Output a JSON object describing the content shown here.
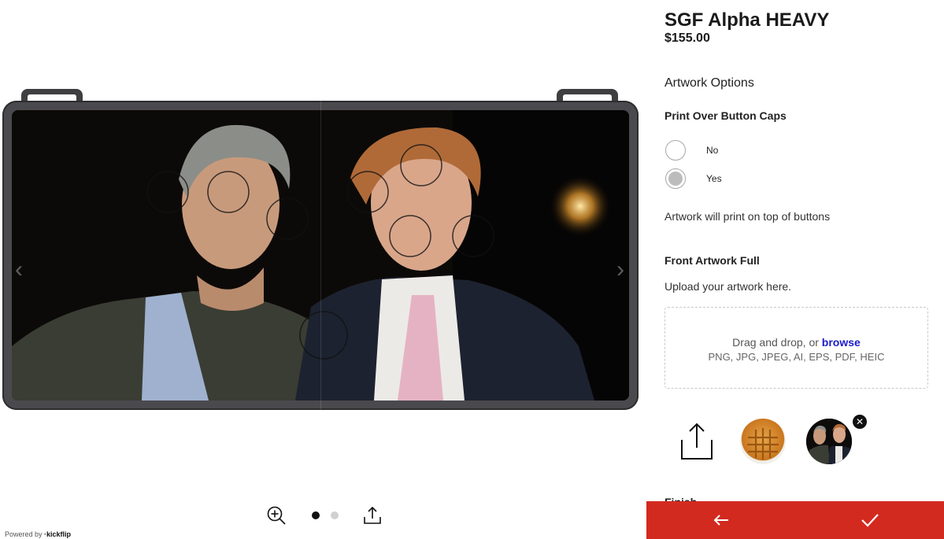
{
  "product": {
    "title": "SGF Alpha HEAVY",
    "price": "$155.00"
  },
  "options": {
    "section_title": "Artwork Options",
    "print_over": {
      "label": "Print Over Button Caps",
      "choices": [
        "No",
        "Yes"
      ],
      "selected": "Yes"
    },
    "note": "Artwork will print on top of buttons",
    "front_artwork": {
      "label": "Front Artwork Full",
      "hint": "Upload your artwork here.",
      "dropzone_text": "Drag and drop, or",
      "dropzone_link": "browse",
      "formats": "PNG, JPG, JPEG, AI, EPS, PDF, HEIC"
    },
    "finish_label": "Finish"
  },
  "preview": {
    "powered_prefix": "Powered by",
    "powered_brand": "·kickflip",
    "image_count": 2,
    "active_image": 1,
    "icons": {
      "zoom": "zoom-in-icon",
      "upload": "upload-icon",
      "prev": "chevron-left-icon",
      "next": "chevron-right-icon"
    }
  },
  "actions": {
    "back_icon": "arrow-left-icon",
    "confirm_icon": "checkmark-icon"
  },
  "colors": {
    "accent": "#d32a1f",
    "link": "#1a1acc",
    "controller_body": "#4a4a4e"
  }
}
